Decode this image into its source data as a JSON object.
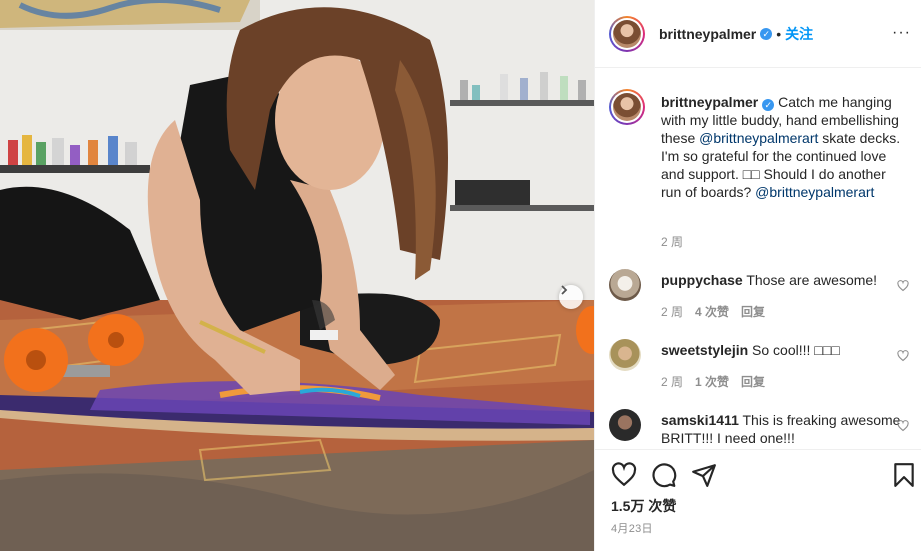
{
  "post": {
    "username": "brittneypalmer",
    "verified_icon": "✓",
    "dot": "•",
    "follow_label": "关注",
    "more_icon": "···",
    "caption": {
      "username": "brittneypalmer",
      "text_before": "Catch me hanging with my little buddy, hand embellishing these ",
      "mention1": "@brittneypalmerart",
      "text_middle": " skate decks. I'm so grateful for the continued love and support. □□ Should I do another run of boards? ",
      "mention2": "@brittneypalmerart",
      "time": "2 周"
    },
    "comments": [
      {
        "username": "puppychase",
        "text": "Those are awesome!",
        "time": "2 周",
        "likes": "4 次赞",
        "reply": "回复"
      },
      {
        "username": "sweetstylejin",
        "text": "So cool!!! □□□",
        "time": "2 周",
        "likes": "1 次赞",
        "reply": "回复"
      },
      {
        "username": "samski1411",
        "text": "This is freaking awesome BRITT!!! I need one!!!"
      }
    ],
    "likes_count": "1.5万 次赞",
    "date": "4月23日"
  },
  "colors": {
    "accent": "#0095f6",
    "verified": "#3897f0",
    "muted": "#8e8e8e",
    "wheel_orange": "#f2711c"
  },
  "icons": [
    "heart-icon",
    "comment-icon",
    "share-icon",
    "bookmark-icon",
    "chevron-right-icon",
    "more-icon",
    "verified-badge-icon"
  ]
}
